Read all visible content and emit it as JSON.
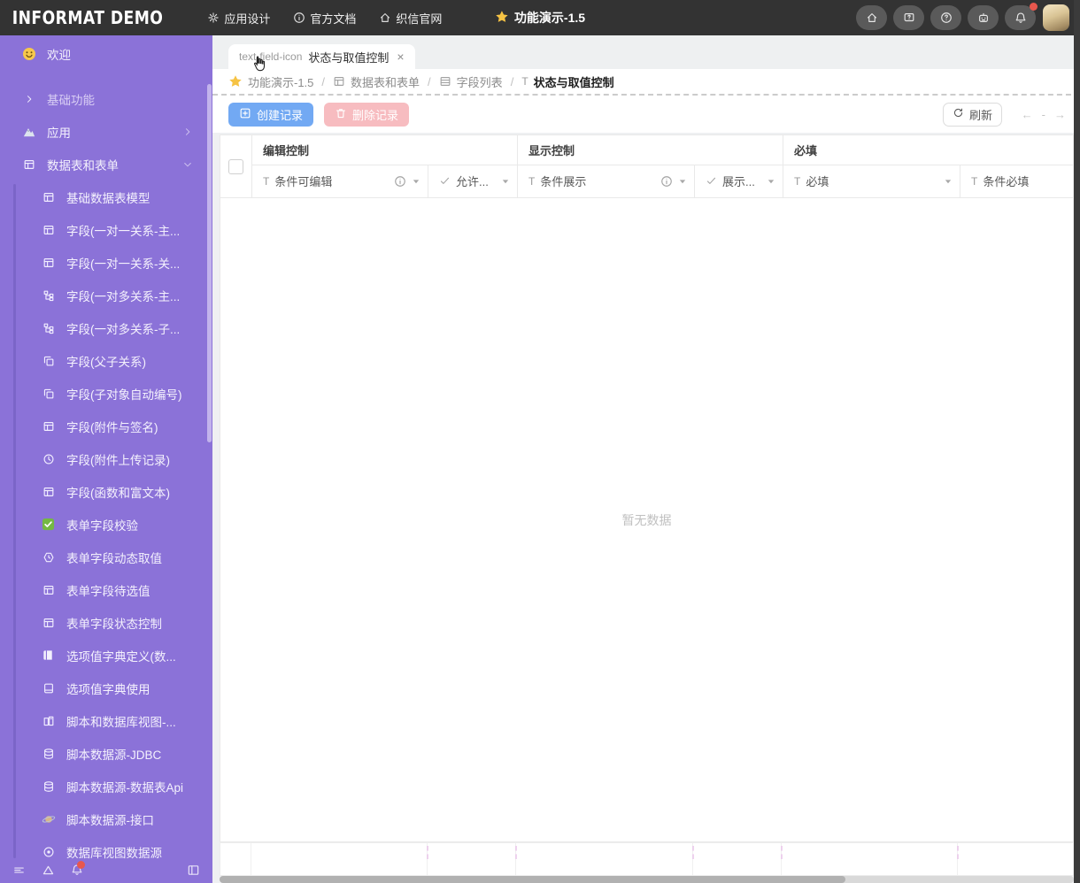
{
  "header": {
    "logo": "INFORMAT DEMO",
    "nav": [
      {
        "icon": "gear-icon",
        "label": "应用设计"
      },
      {
        "icon": "info-icon",
        "label": "官方文档"
      },
      {
        "icon": "home-icon",
        "label": "织信官网"
      }
    ],
    "title": "功能演示-1.5",
    "title_icon": "star-icon",
    "actions": [
      {
        "icon": "home-icon"
      },
      {
        "icon": "feedback-icon"
      },
      {
        "icon": "help-icon"
      },
      {
        "icon": "robot-icon"
      },
      {
        "icon": "bell-icon",
        "badge": true
      }
    ]
  },
  "sidebar": {
    "items": [
      {
        "icon": "smiley-icon",
        "label": "欢迎",
        "level": 0
      },
      {
        "icon": "chevron-right-icon",
        "label": "基础功能",
        "level": 0,
        "dim": true,
        "gap": true
      },
      {
        "icon": "mountain-icon",
        "label": "应用",
        "level": 0,
        "trailing": "chevron-right-icon"
      },
      {
        "icon": "table-icon",
        "label": "数据表和表单",
        "level": 0,
        "trailing": "chevron-down-icon"
      },
      {
        "icon": "table-icon",
        "label": "基础数据表模型",
        "level": 1
      },
      {
        "icon": "table-icon",
        "label": "字段(一对一关系-主...",
        "level": 1
      },
      {
        "icon": "table-icon",
        "label": "字段(一对一关系-关...",
        "level": 1
      },
      {
        "icon": "tree-icon",
        "label": "字段(一对多关系-主...",
        "level": 1
      },
      {
        "icon": "tree-icon",
        "label": "字段(一对多关系-子...",
        "level": 1
      },
      {
        "icon": "copy-icon",
        "label": "字段(父子关系)",
        "level": 1
      },
      {
        "icon": "copy-icon",
        "label": "字段(子对象自动编号)",
        "level": 1
      },
      {
        "icon": "table-icon",
        "label": "字段(附件与签名)",
        "level": 1
      },
      {
        "icon": "history-icon",
        "label": "字段(附件上传记录)",
        "level": 1
      },
      {
        "icon": "table-icon",
        "label": "字段(函数和富文本)",
        "level": 1
      },
      {
        "icon": "check-green-icon",
        "label": "表单字段校验",
        "level": 1
      },
      {
        "icon": "timer-icon",
        "label": "表单字段动态取值",
        "level": 1
      },
      {
        "icon": "table-icon",
        "label": "表单字段待选值",
        "level": 1
      },
      {
        "icon": "table-icon",
        "label": "表单字段状态控制",
        "level": 1
      },
      {
        "icon": "book-icon",
        "label": "选项值字典定义(数...",
        "level": 1
      },
      {
        "icon": "book-open-icon",
        "label": "选项值字典使用",
        "level": 1
      },
      {
        "icon": "books-icon",
        "label": "脚本和数据库视图-...",
        "level": 1
      },
      {
        "icon": "database-icon",
        "label": "脚本数据源-JDBC",
        "level": 1
      },
      {
        "icon": "database-icon",
        "label": "脚本数据源-数据表Api",
        "level": 1
      },
      {
        "icon": "planet-icon",
        "label": "脚本数据源-接口",
        "level": 1
      },
      {
        "icon": "target-icon",
        "label": "数据库视图数据源",
        "level": 1
      }
    ],
    "footer_icons": [
      {
        "icon": "menu-lines-icon"
      },
      {
        "icon": "triangle-icon"
      },
      {
        "icon": "bell-icon",
        "badge": true
      },
      {
        "icon": "panel-icon",
        "right": true
      }
    ]
  },
  "tab": {
    "icon": "text-field-icon",
    "label": "状态与取值控制",
    "close": "×"
  },
  "breadcrumb": {
    "separator": "/",
    "items": [
      {
        "icon": "star-icon",
        "label": "功能演示-1.5"
      },
      {
        "icon": "table-icon",
        "label": "数据表和表单"
      },
      {
        "icon": "list-table-icon",
        "label": "字段列表"
      },
      {
        "icon": "text-field-icon",
        "label": "状态与取值控制",
        "current": true
      }
    ]
  },
  "toolbar": {
    "create_label": "创建记录",
    "delete_label": "删除记录",
    "refresh_label": "刷新",
    "pagination": {
      "prev": "←",
      "mid": "-",
      "next": "→"
    }
  },
  "table": {
    "groups": [
      {
        "label": "编辑控制"
      },
      {
        "label": "显示控制"
      },
      {
        "label": "必填"
      }
    ],
    "columns": [
      {
        "icon": "text-field-icon",
        "label": "条件可编辑",
        "info": true,
        "caret": true
      },
      {
        "icon": "check-icon",
        "label": "允许...",
        "caret": true
      },
      {
        "icon": "text-field-icon",
        "label": "条件展示",
        "info": true,
        "caret": true
      },
      {
        "icon": "check-icon",
        "label": "展示...",
        "caret": true
      },
      {
        "icon": "text-field-icon",
        "label": "必填",
        "caret": true
      },
      {
        "icon": "text-field-icon",
        "label": "条件必填"
      }
    ],
    "empty_text": "暂无数据"
  },
  "colors": {
    "header_bg": "#333333",
    "sidebar_bg": "#8b72d8",
    "primary_button": "#72a9f3",
    "delete_button": "#f7bcc0",
    "notification_dot": "#e8574d",
    "star": "#f6c344"
  }
}
